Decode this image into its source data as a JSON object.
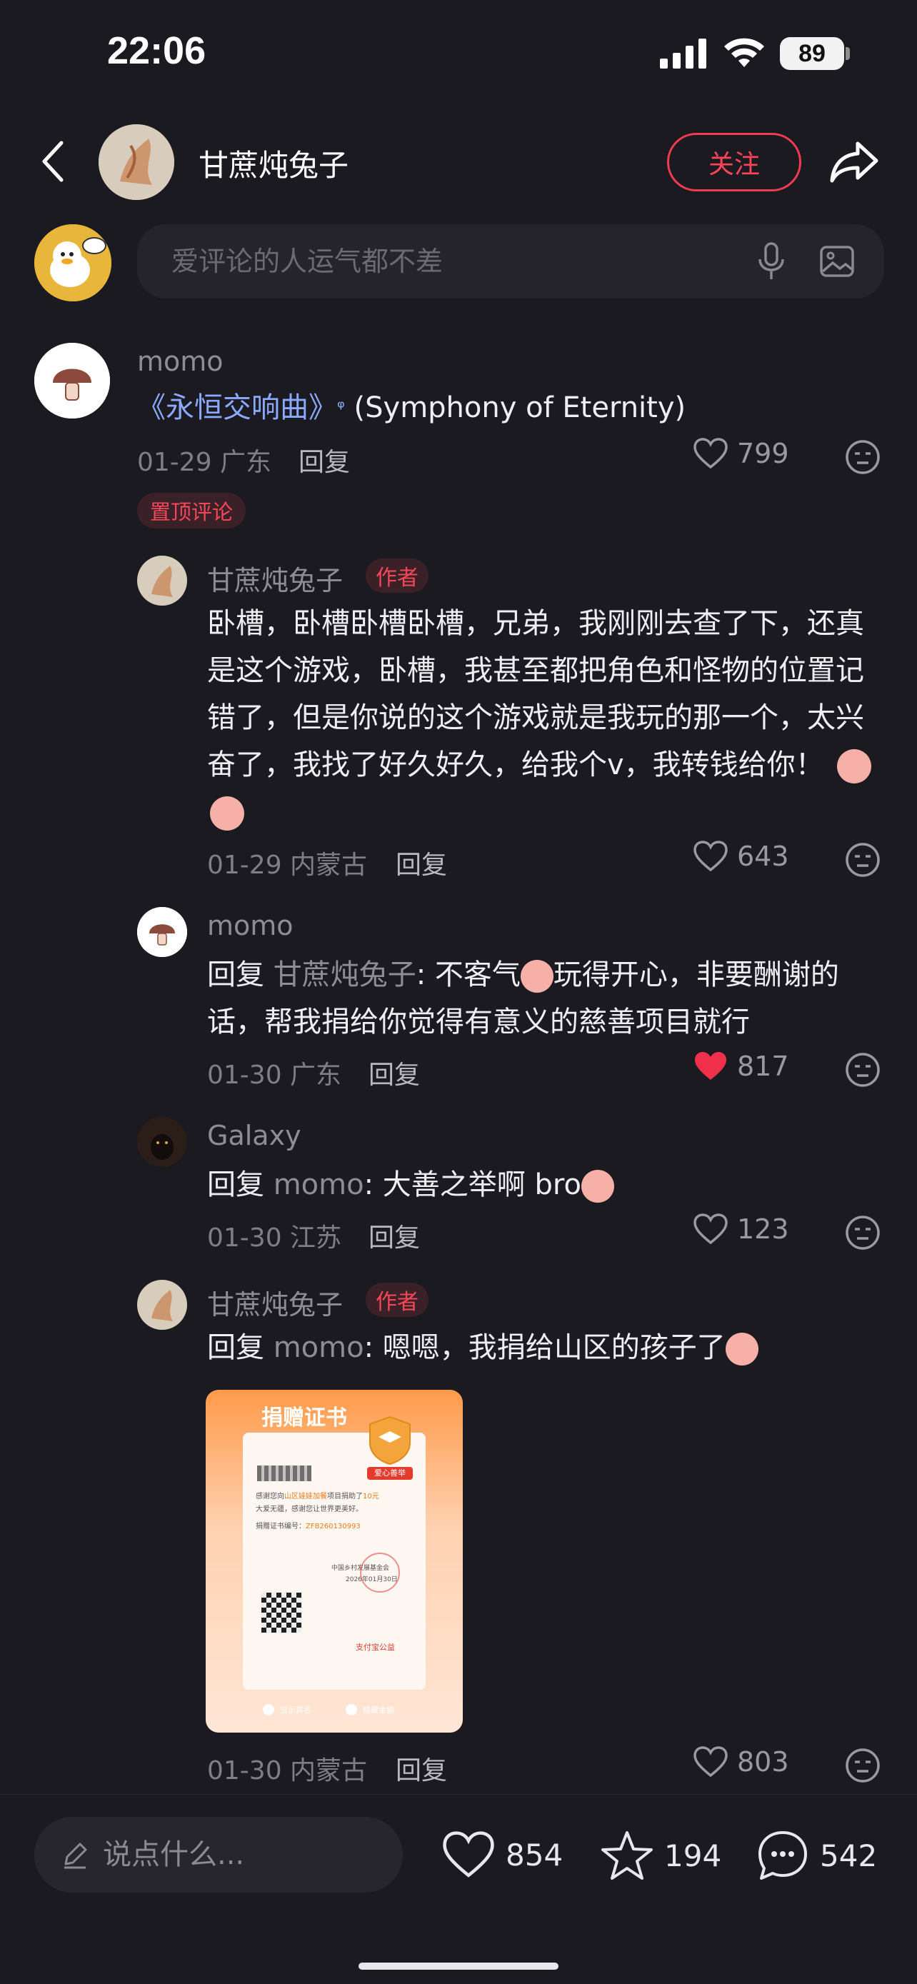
{
  "status": {
    "time": "22:06",
    "battery": "89"
  },
  "header": {
    "author": "甘蔗炖兔子",
    "follow_label": "关注"
  },
  "comment_box": {
    "placeholder": "爱评论的人运气都不差"
  },
  "comments": [
    {
      "user": "momo",
      "title_link": "《永恒交响曲》",
      "text_suffix": "(Symphony of Eternity)",
      "date": "01-29 广东",
      "reply_label": "回复",
      "likes": "799",
      "pinned_label": "置顶评论"
    },
    {
      "user": "甘蔗炖兔子",
      "author_tag": "作者",
      "text": "卧槽，卧槽卧槽卧槽，兄弟，我刚刚去查了下，还真是这个游戏，卧槽，我甚至都把角色和怪物的位置记错了，但是你说的这个游戏就是我玩的那一个，太兴奋了，我找了好久好久，给我个v，我转钱给你！",
      "date": "01-29 内蒙古",
      "reply_label": "回复",
      "likes": "643"
    },
    {
      "user": "momo",
      "reply_prefix": "回复",
      "reply_to": "甘蔗炖兔子",
      "text_a": ": 不客气",
      "text_b": "玩得开心，非要酬谢的话，帮我捐给你觉得有意义的慈善项目就行",
      "date": "01-30 广东",
      "reply_label": "回复",
      "likes": "817"
    },
    {
      "user": "Galaxy",
      "reply_prefix": "回复",
      "reply_to": "momo",
      "text": ": 大善之举啊 bro",
      "date": "01-30 江苏",
      "reply_label": "回复",
      "likes": "123"
    },
    {
      "user": "甘蔗炖兔子",
      "author_tag": "作者",
      "reply_prefix": "回复",
      "reply_to": "momo",
      "text": ": 嗯嗯，我捐给山区的孩子了",
      "date": "01-30 内蒙古",
      "reply_label": "回复",
      "likes": "803"
    }
  ],
  "certificate": {
    "title": "捐赠证书",
    "badge": "爱心善举",
    "line1_a": "感谢您向",
    "line1_link": "山区娃娃加餐",
    "line1_b": "项目捐助了",
    "amount": "10元",
    "line2": "大爱无疆，感谢您让世界更美好。",
    "cert_label": "捐赠证书编号：",
    "cert_no": "ZFB260130993",
    "org": "中国乡村发展基金会",
    "cert_date": "2026年01月30日",
    "brand": "支付宝公益",
    "opt_real_name": "显示真名",
    "opt_hide_amount": "隐藏金额"
  },
  "bottom": {
    "placeholder": "说点什么...",
    "likes": "854",
    "favorites": "194",
    "comments": "542"
  }
}
